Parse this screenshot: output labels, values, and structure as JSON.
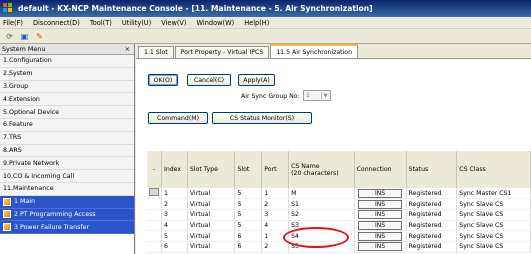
{
  "window": {
    "title": "default - KX-NCP Maintenance Console - [11. Maintenance - 5. Air Synchronization]"
  },
  "menu": [
    "File(F)",
    "Disconnect(D)",
    "Tool(T)",
    "Utility(U)",
    "View(V)",
    "Window(W)",
    "Help(H)"
  ],
  "toolbar": {
    "icons": [
      "refresh-icon",
      "connect-icon",
      "tool-icon"
    ]
  },
  "sidebar": {
    "header": "System Menu",
    "close_glyph": "×",
    "items": [
      "1.Configuration",
      "2.System",
      "3.Group",
      "4.Extension",
      "5.Optional Device",
      "6.Feature",
      "7.TRS",
      "8.ARS",
      "9.Private Network",
      "10.CO & Incoming Call",
      "11.Maintenance"
    ],
    "subitems": [
      "1 Main",
      "2 PT Programming Access",
      "3 Power Failure Transfer"
    ]
  },
  "tabs": [
    "1.1 Slot",
    "Port Property - Virtual IPCS",
    "11.5 Air Synchronization"
  ],
  "buttons": {
    "ok": "OK(O)",
    "cancel": "Cancel(C)",
    "apply": "Apply(A)",
    "command": "Command(M)",
    "cs_status": "CS Status Monitor(S)"
  },
  "group_no": {
    "label": "Air Sync Group No:",
    "value": "1"
  },
  "table": {
    "headers": [
      "-",
      "Index",
      "Slot Type",
      "Slot",
      "Port",
      "CS Name\n(20 characters)",
      "Connection",
      "Status",
      "CS Class"
    ],
    "rows": [
      [
        "1",
        "Virtual",
        "5",
        "1",
        "M",
        "INS",
        "Registered",
        "Sync Master CS1"
      ],
      [
        "2",
        "Virtual",
        "5",
        "2",
        "S1",
        "INS",
        "Registered",
        "Sync Slave CS"
      ],
      [
        "3",
        "Virtual",
        "5",
        "3",
        "S2",
        "INS",
        "Registered",
        "Sync Slave CS"
      ],
      [
        "4",
        "Virtual",
        "5",
        "4",
        "S3",
        "INS",
        "Registered",
        "Sync Slave CS"
      ],
      [
        "5",
        "Virtual",
        "6",
        "1",
        "S4",
        "INS",
        "Registered",
        "Sync Slave CS"
      ],
      [
        "6",
        "Virtual",
        "6",
        "2",
        "S5",
        "INS",
        "Registered",
        "Sync Slave CS"
      ]
    ]
  },
  "annotation_color": "#e31010"
}
